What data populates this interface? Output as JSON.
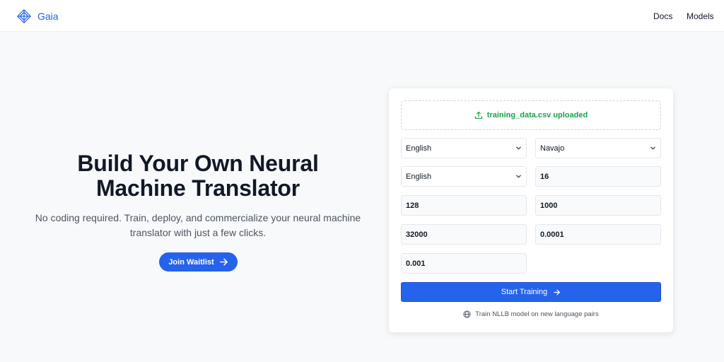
{
  "header": {
    "brand": "Gaia",
    "nav": {
      "docs": "Docs",
      "models": "Models"
    }
  },
  "hero": {
    "title": "Build Your Own Neural Machine Translator",
    "subtitle": "No coding required. Train, deploy, and commercialize your neural machine translator with just a few clicks.",
    "cta_label": "Join Waitlist"
  },
  "form": {
    "upload_status": "training_data.csv uploaded",
    "source_language": "English",
    "target_language": "Navajo",
    "third_select": "English",
    "fields": [
      "16",
      "128",
      "1000",
      "32000",
      "0.0001",
      "0.001"
    ],
    "submit_label": "Start Training",
    "footnote": "Train NLLB model on new language pairs"
  },
  "colors": {
    "accent": "#2563eb",
    "success": "#16a34a",
    "background": "#f8f9fa"
  },
  "icons": [
    "gaia-logo-icon",
    "arrow-right-icon",
    "upload-icon",
    "chevron-down-icon",
    "globe-icon"
  ]
}
